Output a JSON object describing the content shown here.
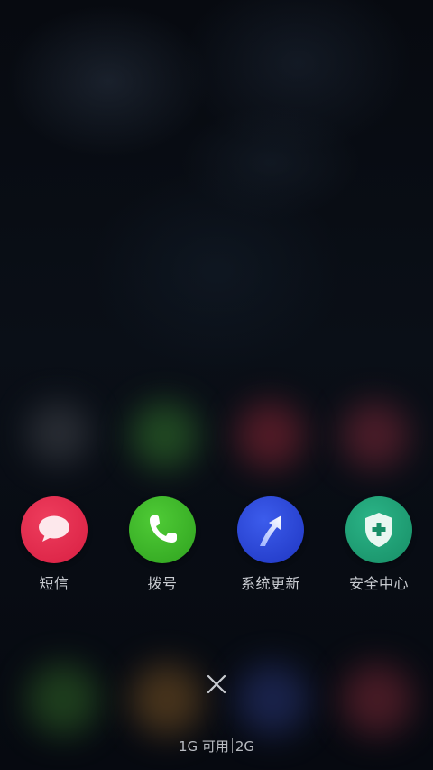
{
  "apps": [
    {
      "label": "短信",
      "icon": "message-icon",
      "color": "#e3274b"
    },
    {
      "label": "拨号",
      "icon": "phone-icon",
      "color": "#3bb42c"
    },
    {
      "label": "系统更新",
      "icon": "update-arrow-icon",
      "color": "#2b47d6"
    },
    {
      "label": "安全中心",
      "icon": "shield-plus-icon",
      "color": "#1f9e77"
    }
  ],
  "close": {
    "icon": "close-icon"
  },
  "memory": {
    "available": "1G 可用",
    "total": "2G"
  }
}
